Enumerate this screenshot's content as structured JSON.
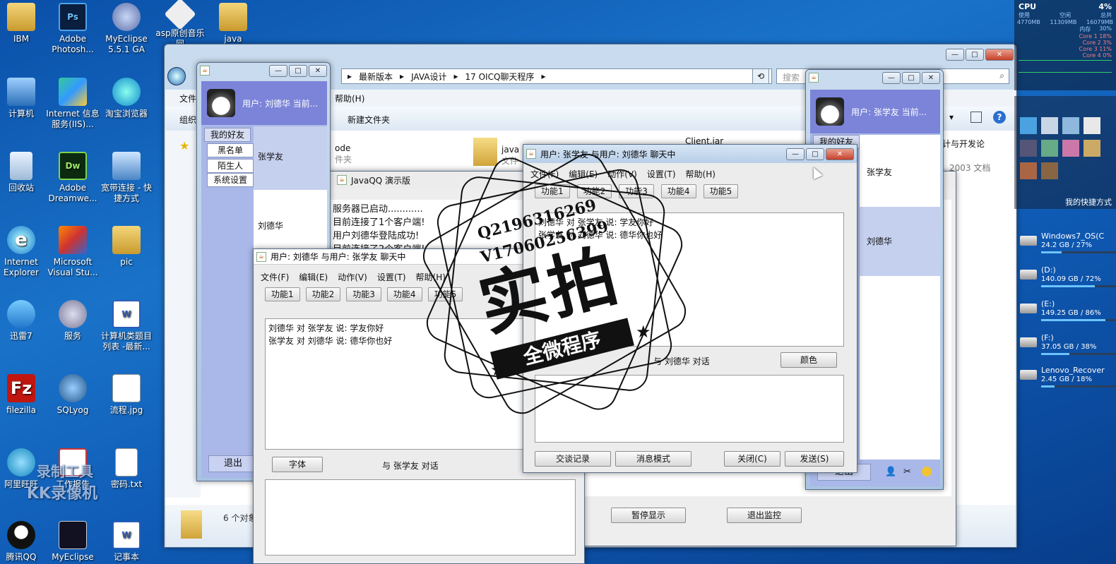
{
  "desktop_icons": [
    {
      "label": "IBM"
    },
    {
      "label": "Adobe Photosh..."
    },
    {
      "label": "MyEclipse 5.5.1 GA"
    },
    {
      "label": "asp原创音乐网"
    },
    {
      "label": "java"
    },
    {
      "label": "计算机"
    },
    {
      "label": "Internet 信息服务(IIS)..."
    },
    {
      "label": "淘宝浏览器"
    },
    {
      "label": "回收站"
    },
    {
      "label": "Adobe Dreamwe..."
    },
    {
      "label": "宽带连接 - 快捷方式"
    },
    {
      "label": "Internet Explorer"
    },
    {
      "label": "Microsoft Visual Stu..."
    },
    {
      "label": "pic"
    },
    {
      "label": "迅雷7"
    },
    {
      "label": "服务"
    },
    {
      "label": "计算机类题目列表 -最新..."
    },
    {
      "label": "filezilla"
    },
    {
      "label": "SQLyog"
    },
    {
      "label": "流程.jpg"
    },
    {
      "label": "阿里旺旺"
    },
    {
      "label": "工作报告"
    },
    {
      "label": "密码.txt"
    },
    {
      "label": "腾讯QQ"
    },
    {
      "label": "MyEclipse"
    },
    {
      "label": "记事本"
    }
  ],
  "explorer": {
    "breadcrumb": [
      "最新版本",
      "JAVA设计",
      "17 OICQ聊天程序"
    ],
    "search_placeholder": "搜索",
    "menu_file": "文件",
    "menu_help": "帮助(H)",
    "organize": "组织",
    "new_folder": "新建文件夹",
    "file_code": "ode",
    "file_code_sub": "件夹",
    "file_java": "java",
    "file_java_sub": "文件",
    "file_client": "Client.jar",
    "right_text_1": "计与开发论",
    "right_text_2": "2003 文档",
    "status": "6 个对象"
  },
  "server_window": {
    "title": "JavaQQ 演示版",
    "log": [
      "服务器已启动............",
      "目前连接了1个客户端!",
      "用户刘德华登陆成功!",
      "目前连接了2个客户端!"
    ],
    "pause_button": "暂停显示",
    "stop_button": "退出监控"
  },
  "client_left": {
    "user_line": "用户: 刘德华 当前...",
    "tab_friends": "我的好友",
    "tab_blacklist": "黑名单",
    "tab_strangers": "陌生人",
    "tab_settings": "系统设置",
    "friend_1": "张学友",
    "friend_2": "刘德华",
    "exit_button": "退出"
  },
  "client_right": {
    "user_line": "用户: 张学友 当前...",
    "tab_friends": "我的好友",
    "friend_1": "张学友",
    "friend_2": "刘德华",
    "exit_button": "退出"
  },
  "chat_front": {
    "title": "用户: 张学友 与用户: 刘德华 聊天中",
    "menus": [
      "文件(F)",
      "编辑(E)",
      "动作(V)",
      "设置(T)",
      "帮助(H)"
    ],
    "functions": [
      "功能1",
      "功能2",
      "功能3",
      "功能4",
      "功能5"
    ],
    "messages": [
      "刘德华 对 张学友 说: 学友你好",
      "张学友 对 刘德华 说: 德华你也好"
    ],
    "talk_with": "与 刘德华 对话",
    "color_button": "颜色",
    "history_button": "交谈记录",
    "mode_button": "消息模式",
    "close_button": "关闭(C)",
    "send_button": "发送(S)"
  },
  "chat_back": {
    "title": "用户: 刘德华 与用户: 张学友 聊天中",
    "menus": [
      "文件(F)",
      "编辑(E)",
      "动作(V)",
      "设置(T)",
      "帮助(H)"
    ],
    "functions": [
      "功能1",
      "功能2",
      "功能3",
      "功能4",
      "功能5"
    ],
    "messages": [
      "刘德华 对 张学友 说: 学友你好",
      "张学友 对 刘德华 说: 德华你也好"
    ],
    "font_button": "字体",
    "talk_with": "与 张学友 对话"
  },
  "stamp": {
    "line1": "Q2196316269",
    "line2": "V17060256399",
    "big": "实拍",
    "ribbon": "全微程序"
  },
  "recorder_watermark": {
    "line1": "录制工具",
    "line2": "KK录像机"
  },
  "cpu_gadget": {
    "label": "CPU",
    "percent": "4%",
    "col1": "使用",
    "col2": "空闲",
    "col3": "总共",
    "mem1": "4770MB",
    "mem2": "11309MB",
    "mem3": "16079MB",
    "mem_label": "内存",
    "mem_pct": "30%",
    "cores": [
      {
        "name": "Core 1",
        "pct": "18%"
      },
      {
        "name": "Core 2",
        "pct": "3%"
      },
      {
        "name": "Core 3",
        "pct": "11%"
      },
      {
        "name": "Core 4",
        "pct": "0%"
      }
    ]
  },
  "shortcut_label": "我的快捷方式",
  "drives": [
    {
      "name": "Windows7_OS(C",
      "info": "24.2 GB / 27%",
      "pct": 27
    },
    {
      "name": "(D:)",
      "info": "140.09 GB / 72%",
      "pct": 72
    },
    {
      "name": "(E:)",
      "info": "149.25 GB / 86%",
      "pct": 86
    },
    {
      "name": "(F:)",
      "info": "37.05 GB / 38%",
      "pct": 38
    },
    {
      "name": "Lenovo_Recover",
      "info": "2.45 GB / 18%",
      "pct": 18
    }
  ],
  "colors": {
    "desktop": "#1565c0",
    "client_panel": "#a9b8e8",
    "client_header": "#7b84d8",
    "selected_friend": "#c5d0ee"
  }
}
